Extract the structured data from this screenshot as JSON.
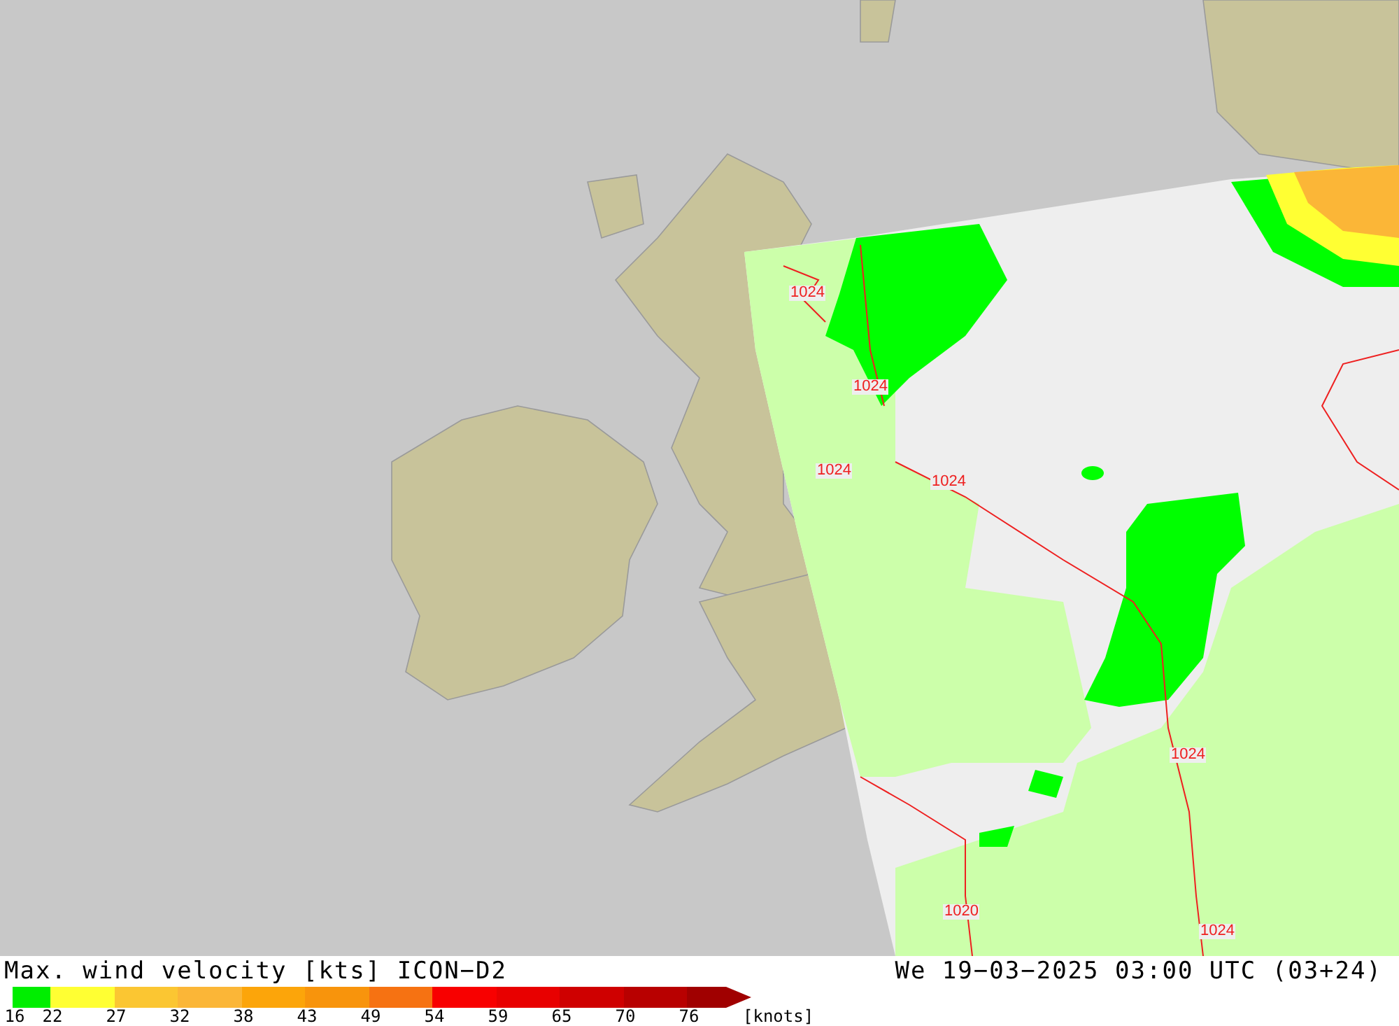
{
  "map": {
    "isobars": [
      {
        "label": "1024"
      },
      {
        "label": "1024"
      },
      {
        "label": "1024"
      },
      {
        "label": "1024"
      },
      {
        "label": "1024"
      },
      {
        "label": "1020"
      },
      {
        "label": "1024"
      }
    ]
  },
  "legend": {
    "title": "Max. wind velocity [kts] ICON−D2",
    "valid_time": "We 19−03−2025 03:00 UTC (03+24)",
    "unit": "[knots]",
    "steps": [
      {
        "label": "16",
        "color": "#00ee00"
      },
      {
        "label": "22",
        "color": "#ffff33"
      },
      {
        "label": "27",
        "color": "#fbc632"
      },
      {
        "label": "32",
        "color": "#fbb637"
      },
      {
        "label": "38",
        "color": "#fca50a"
      },
      {
        "label": "43",
        "color": "#f8940c"
      },
      {
        "label": "49",
        "color": "#f67212"
      },
      {
        "label": "54",
        "color": "#f80000"
      },
      {
        "label": "59",
        "color": "#e80000"
      },
      {
        "label": "65",
        "color": "#cf0000"
      },
      {
        "label": "70",
        "color": "#b80000"
      },
      {
        "label": "76",
        "color": "#a00000"
      }
    ]
  }
}
